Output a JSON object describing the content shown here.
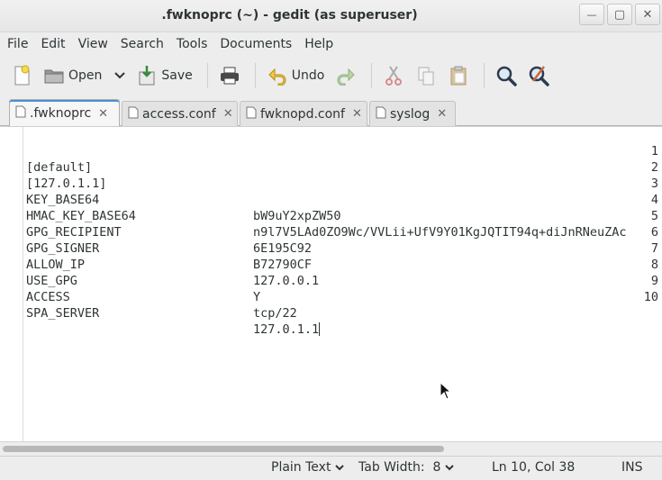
{
  "window": {
    "title": ".fwknoprc (~) - gedit (as superuser)",
    "minimize_glyph": "—",
    "maximize_glyph": "▢",
    "close_glyph": "✕"
  },
  "menu": [
    "File",
    "Edit",
    "View",
    "Search",
    "Tools",
    "Documents",
    "Help"
  ],
  "toolbar": {
    "new_icon": "new-document-icon",
    "open_label": "Open",
    "save_label": "Save",
    "undo_label": "Undo"
  },
  "tabs": [
    {
      "label": ".fwknoprc",
      "active": true
    },
    {
      "label": "access.conf",
      "active": false
    },
    {
      "label": "fwknopd.conf",
      "active": false
    },
    {
      "label": "syslog",
      "active": false
    }
  ],
  "editor": {
    "lines": [
      {
        "n": "1",
        "key": "[default]",
        "val": ""
      },
      {
        "n": "2",
        "key": "[127.0.1.1]",
        "val": ""
      },
      {
        "n": "3",
        "key": "KEY_BASE64",
        "val": "bW9uY2xpZW50"
      },
      {
        "n": "4",
        "key": "HMAC_KEY_BASE64",
        "val": "n9l7V5LAd0ZO9Wc/VVLii+UfV9Y01KgJQTIT94q+diJnRNeuZAc"
      },
      {
        "n": "5",
        "key": "GPG_RECIPIENT",
        "val": "6E195C92"
      },
      {
        "n": "6",
        "key": "GPG_SIGNER",
        "val": "B72790CF"
      },
      {
        "n": "7",
        "key": "ALLOW_IP",
        "val": "127.0.0.1"
      },
      {
        "n": "8",
        "key": "USE_GPG",
        "val": "Y"
      },
      {
        "n": "9",
        "key": "ACCESS",
        "val": "tcp/22"
      },
      {
        "n": "10",
        "key": "SPA_SERVER",
        "val": "127.0.1.1"
      }
    ]
  },
  "status": {
    "language": "Plain Text",
    "tab_width": "Tab Width:  8",
    "position": "Ln 10, Col 38",
    "mode": "INS"
  }
}
